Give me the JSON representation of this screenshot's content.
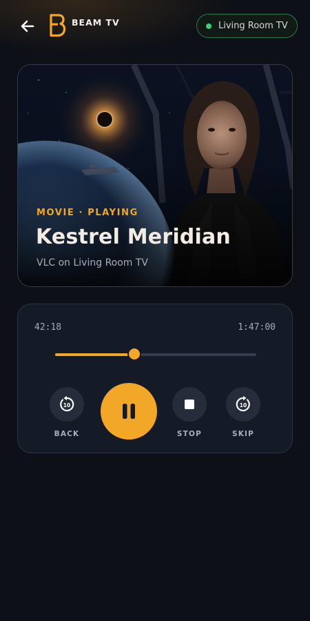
{
  "header": {
    "brand_name": "BEAM TV",
    "device_name": "Living Room TV",
    "device_status_color": "#34d27a"
  },
  "now_playing": {
    "meta": "MOVIE · PLAYING",
    "title": "Kestrel Meridian",
    "subtitle": "VLC on Living Room TV"
  },
  "player": {
    "elapsed": "42:18",
    "total": "1:47:00",
    "progress_fraction": 0.395,
    "controls": {
      "back_label": "BACK",
      "stop_label": "STOP",
      "skip_label": "SKIP",
      "back_icon_text": "10",
      "skip_icon_text": "10"
    }
  },
  "colors": {
    "accent": "#f2a826",
    "background": "#0d1017",
    "panel": "#141a26"
  },
  "icons": {
    "back": "arrow-left-icon",
    "logo": "beam-logo",
    "rewind": "replay-10-icon",
    "pause": "pause-icon",
    "stop": "stop-icon",
    "forward": "forward-10-icon"
  }
}
